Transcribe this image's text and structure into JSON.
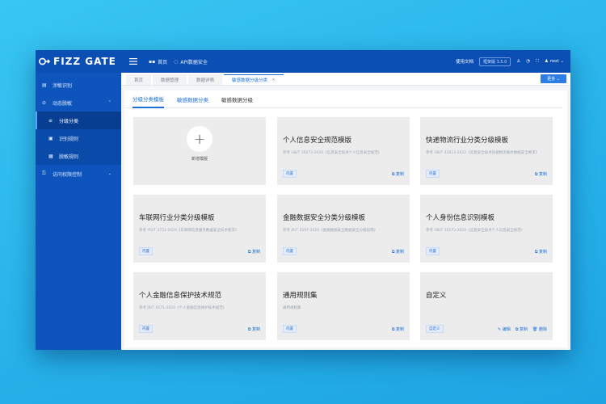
{
  "header": {
    "logo_text": "FIZZ GATE",
    "nav": [
      {
        "icon": "grid-icon",
        "label": "首页"
      },
      {
        "icon": "shield-icon",
        "label": "API数据安全"
      }
    ],
    "docs_label": "使用文档",
    "version": "框架版 3.5.0",
    "user": "root"
  },
  "sidebar": {
    "items": [
      {
        "label": "涉敏识别"
      },
      {
        "label": "动态脱敏"
      },
      {
        "label": "分级分类"
      },
      {
        "label": "识别规则"
      },
      {
        "label": "脱敏规则"
      },
      {
        "label": "访问权限控制"
      }
    ]
  },
  "tabs": [
    {
      "label": "首页"
    },
    {
      "label": "数据管理"
    },
    {
      "label": "数据详情"
    },
    {
      "label": "敏感数据分级分类"
    }
  ],
  "more_label": "更多",
  "subtabs": [
    {
      "label": "分级分类模板"
    },
    {
      "label": "敏感数据分类"
    },
    {
      "label": "敏感数据分级"
    }
  ],
  "add_card": {
    "label": "新增模版"
  },
  "cards": [
    {
      "title": "个人信息安全规范模版",
      "ref": "参考 GB/T 35273-2020《信息安全技术个人信息安全规范》",
      "tag": "内置",
      "actions": [
        "复制"
      ]
    },
    {
      "title": "快递物流行业分类分级模板",
      "ref": "参考 GB/T 42013-2022《信息安全技术快递物流服务数据安全要求》",
      "tag": "内置",
      "actions": [
        "复制"
      ]
    },
    {
      "title": "车联网行业分类分级模板",
      "ref": "参考 YD/T 3751-2020《车联网信息服务数据安全技术要求》",
      "tag": "内置",
      "actions": [
        "复制"
      ]
    },
    {
      "title": "金融数据安全分类分级模板",
      "ref": "参考 JR/T 0197-2020《金融数据安全数据安全分级指南》",
      "tag": "内置",
      "actions": [
        "复制"
      ]
    },
    {
      "title": "个人身份信息识别模板",
      "ref": "参考 GB/T 35273-2020《信息安全技术个人信息安全规范》",
      "tag": "内置",
      "actions": [
        "复制"
      ]
    },
    {
      "title": "个人金融信息保护技术规范",
      "ref": "参考 JR/T 0171-2020《个人金融信息保护技术规范》",
      "tag": "内置",
      "actions": [
        "复制"
      ]
    },
    {
      "title": "通用规则集",
      "ref": "通用规则集",
      "tag": "内置",
      "actions": [
        "复制"
      ]
    },
    {
      "title": "自定义",
      "ref": "",
      "tag": "自定义",
      "actions": [
        "编辑",
        "复制",
        "删除"
      ]
    }
  ]
}
